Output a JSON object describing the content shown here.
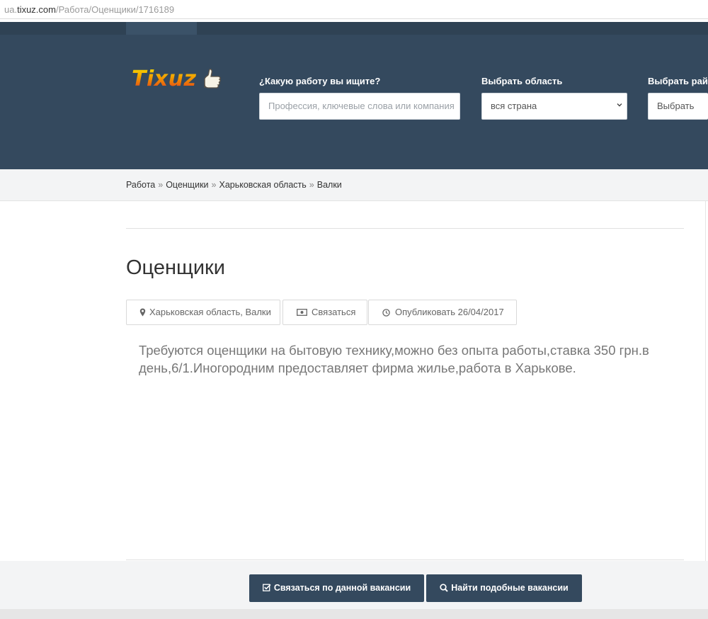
{
  "browser": {
    "url_prefix": "ua.",
    "url_host": "tixuz.com",
    "url_path": "/Работа/Оценщики/1716189"
  },
  "header": {
    "logo_text": "Tixuz",
    "search": {
      "label": "¿Какую работу вы ищите?",
      "placeholder": "Профессия, ключевые слова или компания"
    },
    "region": {
      "label": "Выбрать область",
      "value": "вся страна"
    },
    "district": {
      "label": "Выбрать рай",
      "value": "Выбрать"
    }
  },
  "breadcrumb": {
    "items": [
      "Работа",
      "Оценщики",
      "Харьковская область",
      "Валки"
    ],
    "separator": "»"
  },
  "job": {
    "title": "Оценщики",
    "location": "Харьковская область, Валки",
    "contact": "Связаться",
    "published": "Опубликовать 26/04/2017",
    "description": "Требуются оценщики на бытовую технику,можно без опыта работы,ставка 350 грн.в день,6/1.Иногородним предоставляет фирма жилье,работа в Харькове."
  },
  "actions": {
    "contact_button": "Связаться по данной вакансии",
    "similar_button": "Найти подобные вакансии"
  },
  "colors": {
    "header_bg": "#34495e",
    "button_bg": "#34495e"
  }
}
